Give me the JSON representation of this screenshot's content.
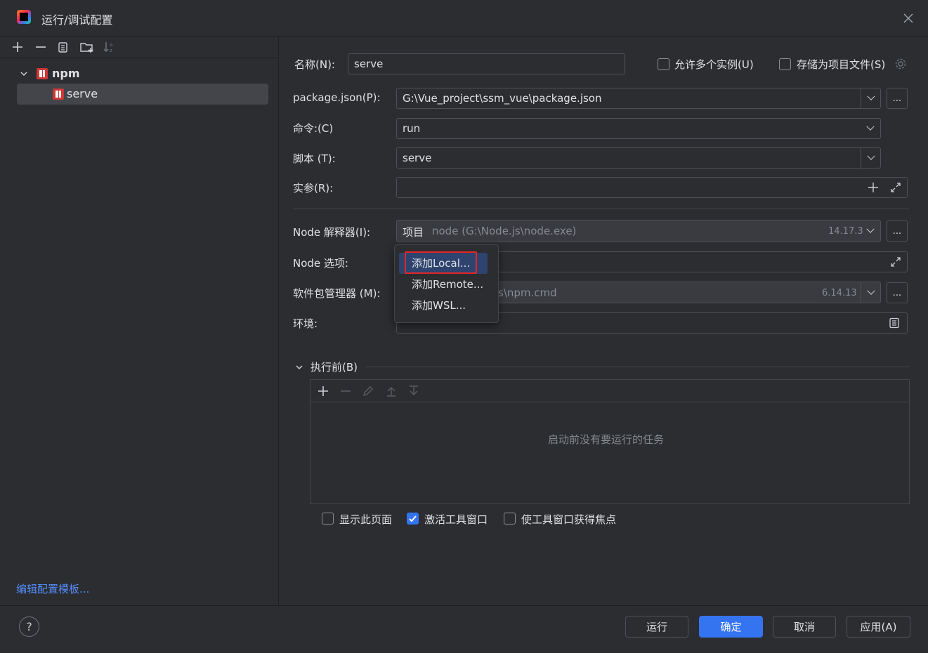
{
  "window": {
    "title": "运行/调试配置"
  },
  "left_toolbar": {
    "icons": [
      "plus-icon",
      "minus-icon",
      "copy-icon",
      "new-folder-icon",
      "sort-icon"
    ]
  },
  "tree": {
    "group": {
      "label": "npm"
    },
    "items": [
      {
        "label": "serve",
        "selected": true
      }
    ]
  },
  "edit_templates_link": "编辑配置模板...",
  "form": {
    "name_label": "名称(N):",
    "name_value": "serve",
    "allow_multiple_label": "允许多个实例(U)",
    "store_as_project_label": "存储为项目文件(S)",
    "package_json_label": "package.json(P):",
    "package_json_value": "G:\\Vue_project\\ssm_vue\\package.json",
    "command_label": "命令:(C)",
    "command_value": "run",
    "script_label": "脚本 (T):",
    "script_value": "serve",
    "args_label": "实参(R):",
    "args_value": "",
    "node_interpreter_label": "Node 解释器(I):",
    "node_interpreter_prefix": "项目",
    "node_interpreter_value": "node (G:\\Node.js\\node.exe)",
    "node_interpreter_version": "14.17.3",
    "node_options_label": "Node 选项:",
    "package_manager_label": "软件包管理器 (M):",
    "package_manager_value": "s\\npm.cmd",
    "package_manager_version": "6.14.13",
    "env_label": "环境:",
    "dots": "..."
  },
  "popup_menu": {
    "items": [
      {
        "label": "添加Local...",
        "selected": true
      },
      {
        "label": "添加Remote...",
        "selected": false
      },
      {
        "label": "添加WSL...",
        "selected": false
      }
    ]
  },
  "before_launch": {
    "header": "执行前(B)",
    "empty_text": "启动前没有要运行的任务"
  },
  "options": {
    "show_page_label": "显示此页面",
    "show_page_checked": false,
    "activate_tool_window_label": "激活工具窗口",
    "activate_tool_window_checked": true,
    "focus_tool_window_label": "使工具窗口获得焦点",
    "focus_tool_window_checked": false
  },
  "buttons": {
    "help": "?",
    "run": "运行",
    "ok": "确定",
    "cancel": "取消",
    "apply": "应用(A)"
  },
  "colors": {
    "accent": "#3574f0",
    "background": "#2b2d30",
    "highlight_red": "#e5252a",
    "link": "#548af7"
  }
}
